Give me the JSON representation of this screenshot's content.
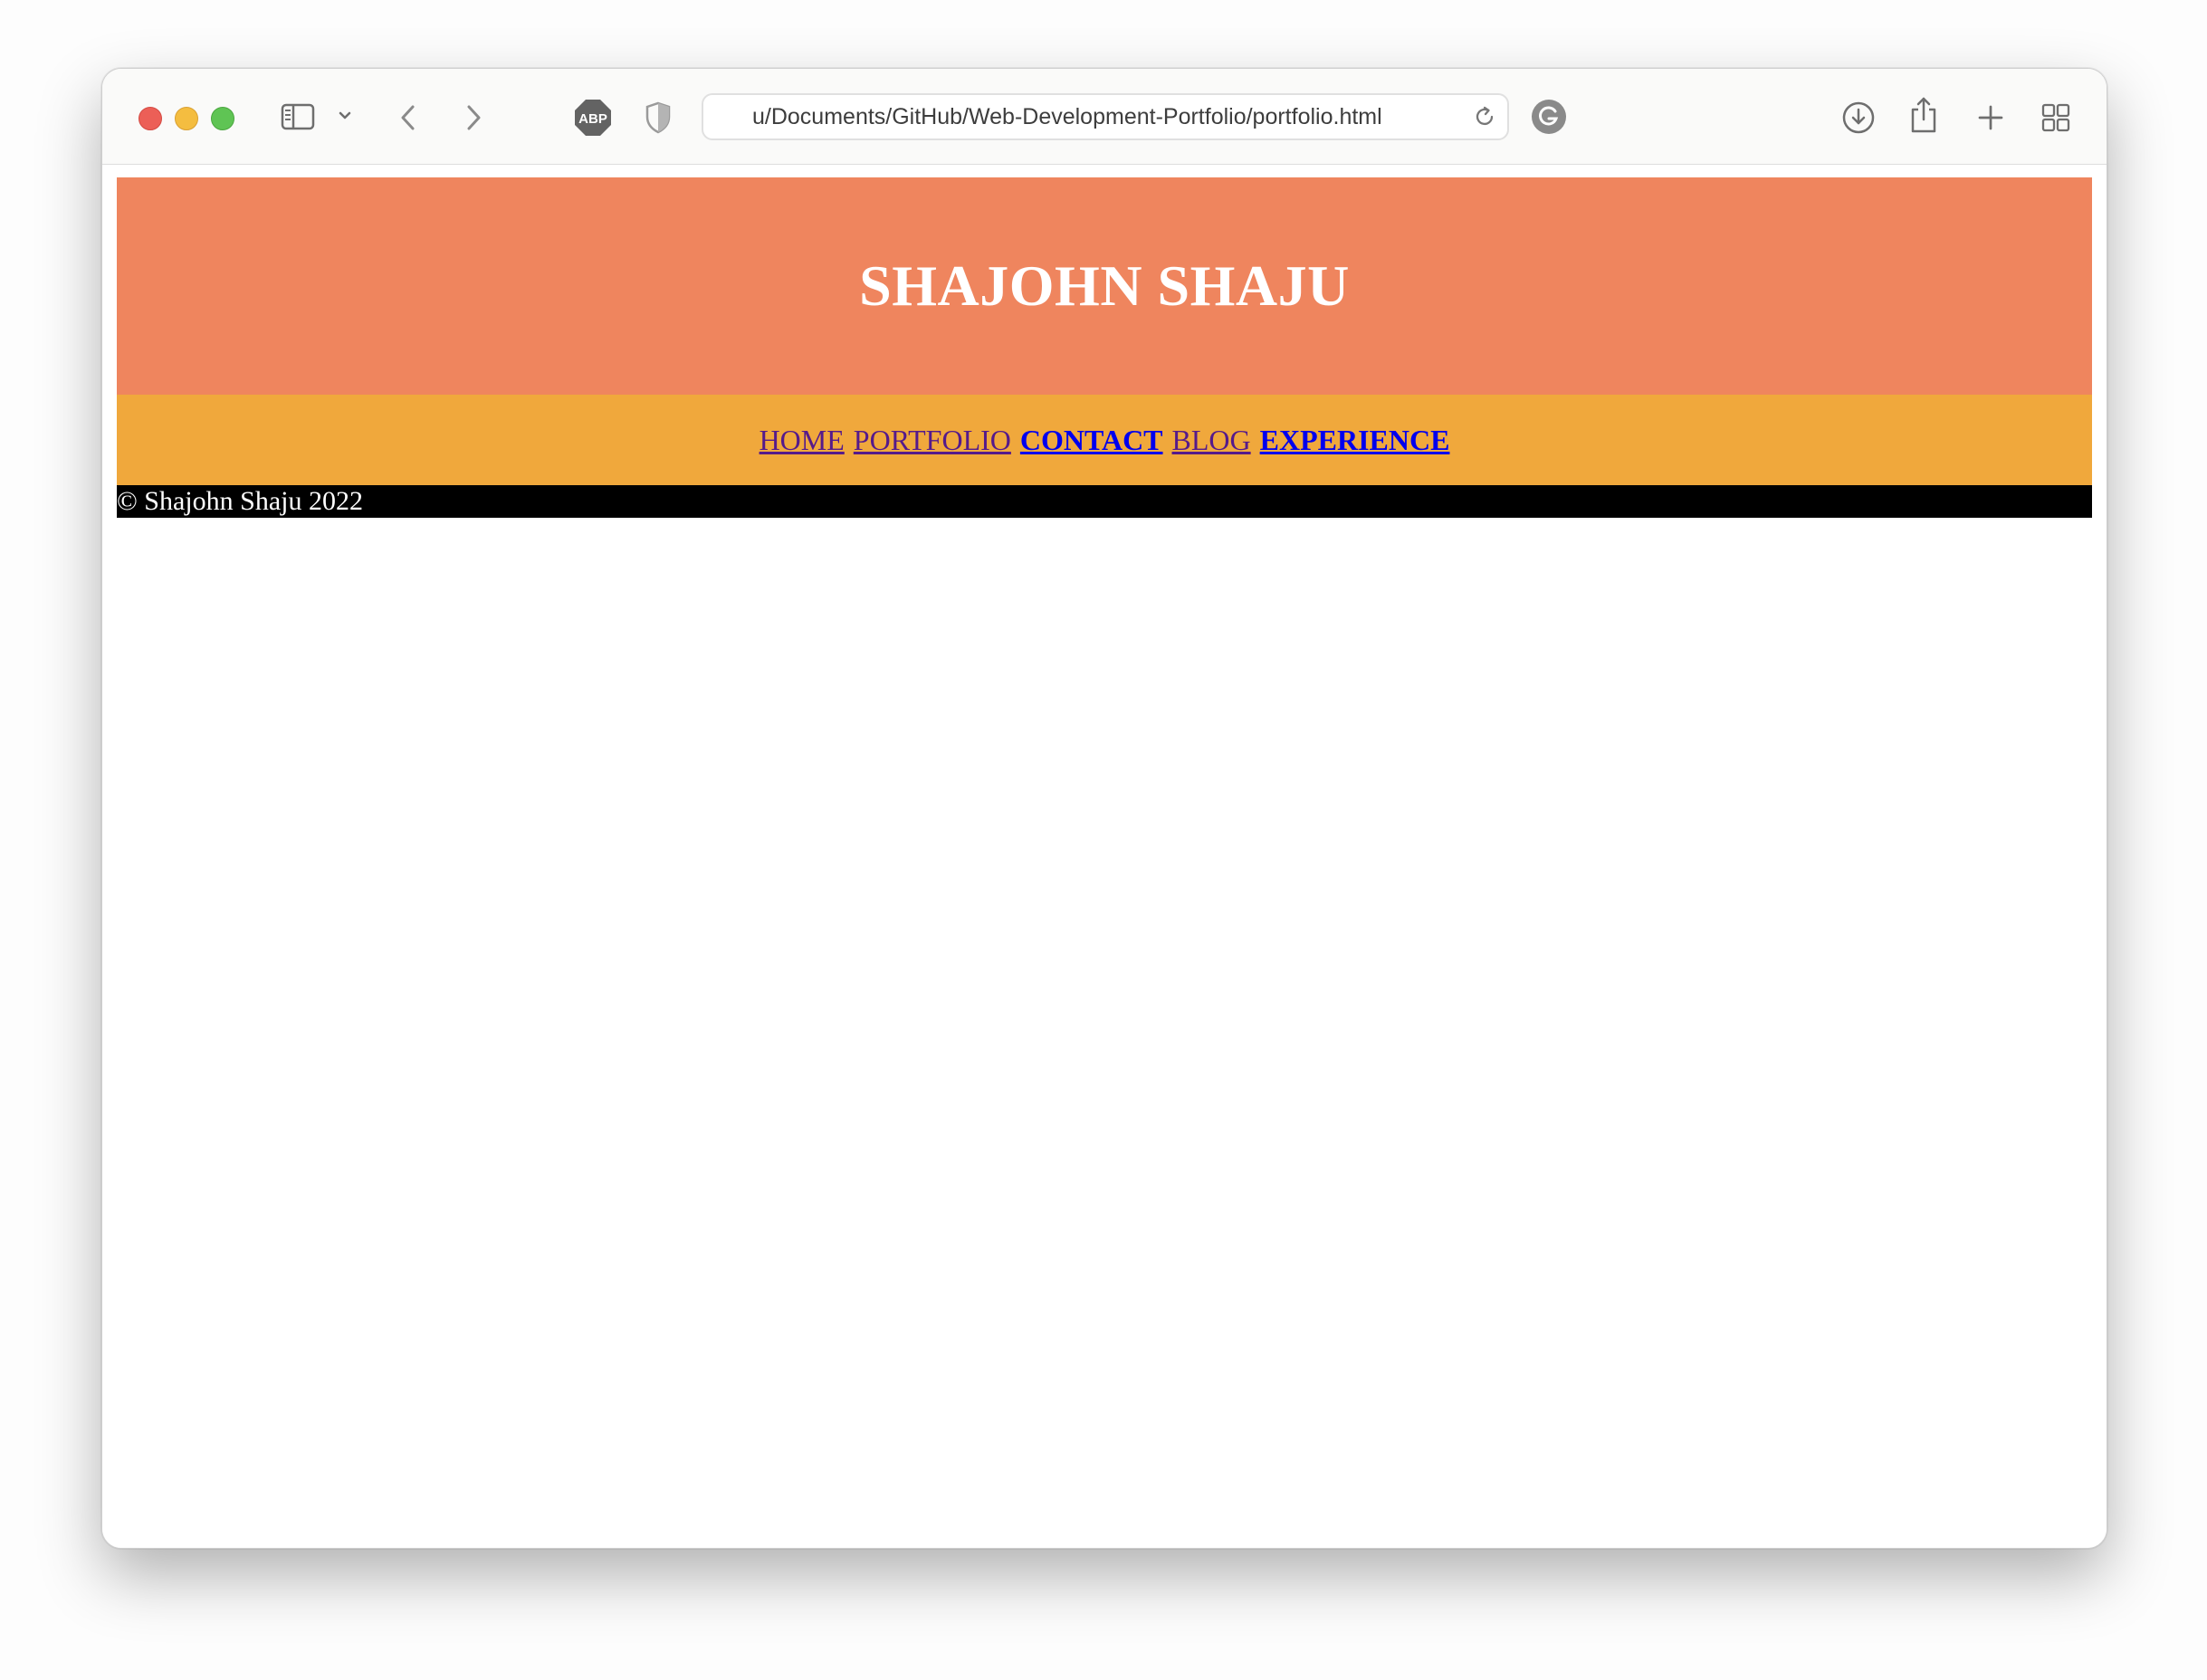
{
  "browser": {
    "address_bar": {
      "url": "u/Documents/GitHub/Web-Development-Portfolio/portfolio.html"
    },
    "extensions": {
      "adblock_label": "ABP"
    },
    "icons": [
      "sidebar-icon",
      "chevron-down-icon",
      "back-icon",
      "forward-icon",
      "adblock-icon",
      "privacy-shield-icon",
      "reload-icon",
      "grammarly-icon",
      "download-icon",
      "share-icon",
      "new-tab-icon",
      "tab-overview-icon"
    ]
  },
  "site": {
    "title": "SHAJOHN SHAJU",
    "nav": [
      {
        "label": "HOME",
        "state": "visited"
      },
      {
        "label": "PORTFOLIO",
        "state": "visited"
      },
      {
        "label": "CONTACT",
        "state": "unvisited"
      },
      {
        "label": "BLOG",
        "state": "visited"
      },
      {
        "label": "EXPERIENCE",
        "state": "unvisited"
      }
    ],
    "footer": "© Shajohn Shaju 2022",
    "colors": {
      "header_bg": "#ef855e",
      "nav_bg": "#f0a83c",
      "footer_bg": "#000000",
      "visited_link": "#551a8b",
      "unvisited_link": "#0000ee"
    }
  }
}
